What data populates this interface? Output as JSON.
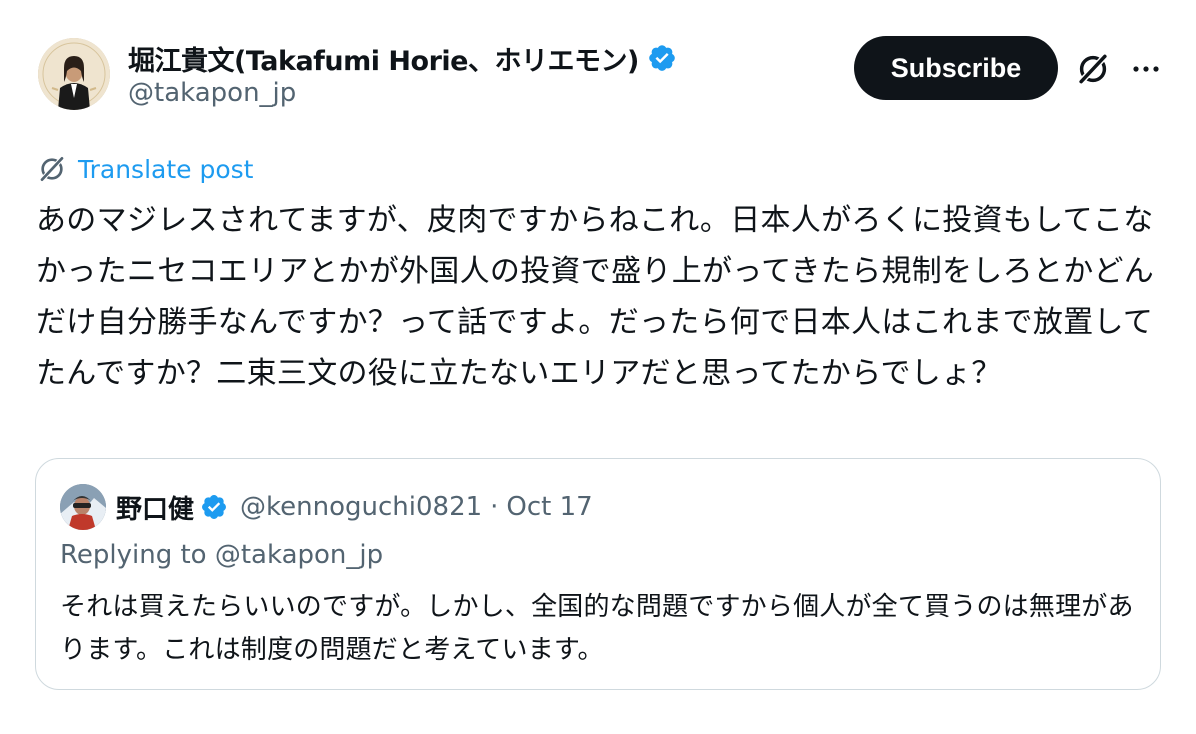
{
  "post": {
    "author": {
      "display_name": "堀江貴文(Takafumi Horie、ホリエモン)",
      "handle": "@takapon_jp",
      "verified": true
    },
    "subscribe_label": "Subscribe",
    "icons": {
      "grok": "grok-icon",
      "more": "more-icon"
    },
    "translate_label": "Translate post",
    "text": "あのマジレスされてますが、皮肉ですからねこれ。日本人がろくに投資もしてこなかったニセコエリアとかが外国人の投資で盛り上がってきたら規制をしろとかどんだけ自分勝手なんですか？って話ですよ。だったら何で日本人はこれまで放置してたんですか？二束三文の役に立たないエリアだと思ってたからでしょ？"
  },
  "quoted": {
    "display_name": "野口健",
    "handle": "@kennoguchi0821",
    "separator": "·",
    "date": "Oct 17",
    "verified": true,
    "replying_to": "Replying to @takapon_jp",
    "text": "それは買えたらいいのですが。しかし、全国的な問題ですから個人が全て買うのは無理があります。これは制度の問題だと考えています。"
  },
  "colors": {
    "accent": "#1d9bf0",
    "text_primary": "#0f1419",
    "text_secondary": "#536471",
    "button_bg": "#0f1419",
    "border": "#cfd9de"
  }
}
